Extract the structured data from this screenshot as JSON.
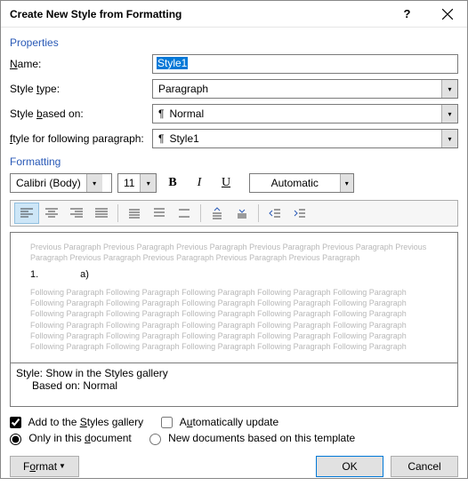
{
  "titlebar": {
    "title": "Create New Style from Formatting"
  },
  "sections": {
    "properties": "Properties",
    "formatting": "Formatting"
  },
  "labels": {
    "name": "Name:",
    "style_type": "Style type:",
    "based_on": "Style based on:",
    "following": "Style for following paragraph:"
  },
  "fields": {
    "name_value": "Style1",
    "style_type_value": "Paragraph",
    "based_on_value": "Normal",
    "following_value": "Style1"
  },
  "format_bar": {
    "font": "Calibri (Body)",
    "size": "11",
    "color": "Automatic"
  },
  "preview": {
    "prev_text": "Previous Paragraph Previous Paragraph Previous Paragraph Previous Paragraph Previous Paragraph Previous Paragraph Previous Paragraph Previous Paragraph Previous Paragraph Previous Paragraph",
    "current_num": "1.",
    "current_sub": "a)",
    "follow_text": "Following Paragraph Following Paragraph Following Paragraph Following Paragraph Following Paragraph Following Paragraph Following Paragraph Following Paragraph Following Paragraph Following Paragraph Following Paragraph Following Paragraph Following Paragraph Following Paragraph Following Paragraph Following Paragraph Following Paragraph Following Paragraph Following Paragraph Following Paragraph Following Paragraph Following Paragraph Following Paragraph Following Paragraph Following Paragraph Following Paragraph Following Paragraph Following Paragraph Following Paragraph Following Paragraph"
  },
  "desc": {
    "line1": "Style: Show in the Styles gallery",
    "line2": "Based on: Normal"
  },
  "options": {
    "add_gallery": "Add to the Styles gallery",
    "auto_update": "Automatically update",
    "only_doc": "Only in this document",
    "new_docs": "New documents based on this template"
  },
  "buttons": {
    "format": "Format",
    "ok": "OK",
    "cancel": "Cancel"
  },
  "mnemonics": {
    "name_u": "N",
    "type_u": "t",
    "based_u": "b",
    "following_u": "f",
    "gallery_u": "S",
    "auto_u": "u",
    "only_u": "d",
    "format_u": "o"
  }
}
